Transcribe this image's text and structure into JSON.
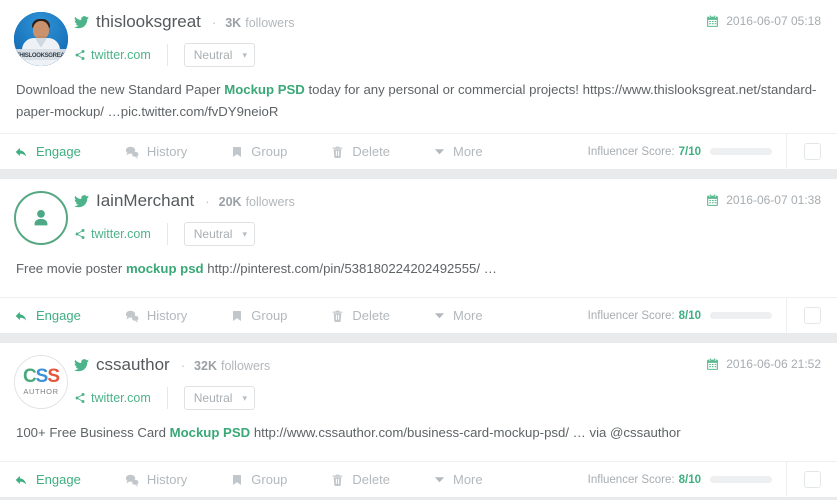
{
  "theme": {
    "accent_green": "#3fae80",
    "muted_text": "#b3b8bc",
    "body_text": "#5e6366",
    "page_bg": "#e9eaec"
  },
  "actions": {
    "engage": "Engage",
    "history": "History",
    "group": "Group",
    "delete": "Delete",
    "more": "More",
    "score_label": "Influencer Score:"
  },
  "common": {
    "domain": "twitter.com",
    "sentiment": "Neutral",
    "followers_label": "followers",
    "separator": "·"
  },
  "posts": [
    {
      "username": "thislooksgreat",
      "followers": "3K",
      "followers_label": "followers",
      "domain": "twitter.com",
      "sentiment": "Neutral",
      "date": "2016-06-07 05:18",
      "avatar_type": "photo",
      "avatar_caption": "THISLOOKSGREAT",
      "text_before": "Download the new Standard Paper ",
      "text_highlight": "Mockup PSD",
      "text_after": " today for any personal or commercial projects! https://www.thislooksgreat.net/standard-paper-mockup/ …pic.twitter.com/fvDY9neioR",
      "score": "7/10",
      "score_percent": 70
    },
    {
      "username": "IainMerchant",
      "followers": "20K",
      "followers_label": "followers",
      "domain": "twitter.com",
      "sentiment": "Neutral",
      "date": "2016-06-07 01:38",
      "avatar_type": "generic",
      "avatar_caption": "",
      "text_before": "Free movie poster ",
      "text_highlight": "mockup psd",
      "text_after": " http://pinterest.com/pin/538180224202492555/ …",
      "score": "8/10",
      "score_percent": 80
    },
    {
      "username": "cssauthor",
      "followers": "32K",
      "followers_label": "followers",
      "domain": "twitter.com",
      "sentiment": "Neutral",
      "date": "2016-06-06 21:52",
      "avatar_type": "csslogo",
      "avatar_caption": "AUTHOR",
      "text_before": "100+ Free Business Card ",
      "text_highlight": "Mockup PSD",
      "text_after": " http://www.cssauthor.com/business-card-mockup-psd/ … via @cssauthor",
      "score": "8/10",
      "score_percent": 80
    }
  ]
}
